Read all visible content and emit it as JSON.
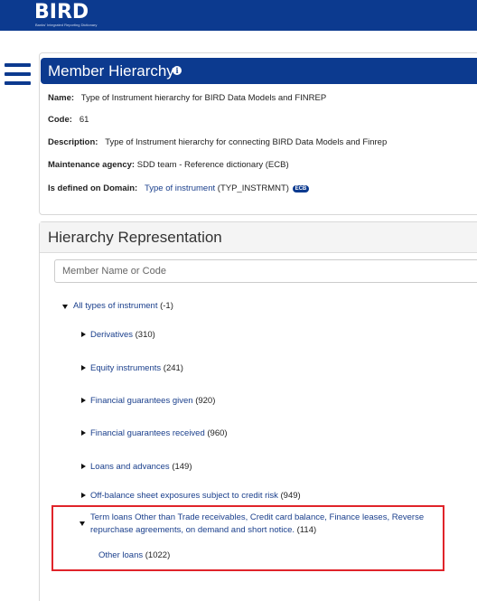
{
  "header": {
    "logo": "BIRD",
    "logo_subtitle": "Banks' Integrated Reporting Dictionary",
    "bar_color": "#0c3a8f"
  },
  "menu": {
    "icon": "hamburger-menu-icon"
  },
  "member_hierarchy": {
    "title": "Member Hierarchy",
    "info_icon": "info-icon",
    "name_label": "Name:",
    "name_value": "Type of Instrument hierarchy for BIRD Data Models and FINREP",
    "code_label": "Code:",
    "code_value": "61",
    "description_label": "Description:",
    "description_value": "Type of Instrument hierarchy for connecting BIRD Data Models and Finrep",
    "agency_label": "Maintenance agency:",
    "agency_value": "SDD team - Reference dictionary (ECB)",
    "domain_label": "Is defined on Domain:",
    "domain_link": "Type of instrument",
    "domain_code": "(TYP_INSTRMNT)",
    "domain_badge": "ECB"
  },
  "hierarchy_representation": {
    "title": "Hierarchy Representation",
    "search_placeholder": "Member Name or Code",
    "root": {
      "label": "All types of instrument",
      "count": "(-1)"
    },
    "children": [
      {
        "label": "Derivatives",
        "count": "(310)"
      },
      {
        "label": "Equity instruments",
        "count": "(241)"
      },
      {
        "label": "Financial guarantees given",
        "count": "(920)"
      },
      {
        "label": "Financial guarantees received",
        "count": "(960)"
      },
      {
        "label": "Loans and advances",
        "count": "(149)"
      },
      {
        "label": "Off-balance sheet exposures subject to credit risk",
        "count": "(949)"
      }
    ],
    "expanded": {
      "label_line1": "Term loans Other than Trade receivables, Credit card balance, Finance leases, Reverse",
      "label_line2": "repurchase agreements, on demand and short notice.",
      "count": "(114)",
      "child": {
        "label": "Other loans",
        "count": "(1022)"
      }
    },
    "highlight_color": "#e0242a"
  }
}
